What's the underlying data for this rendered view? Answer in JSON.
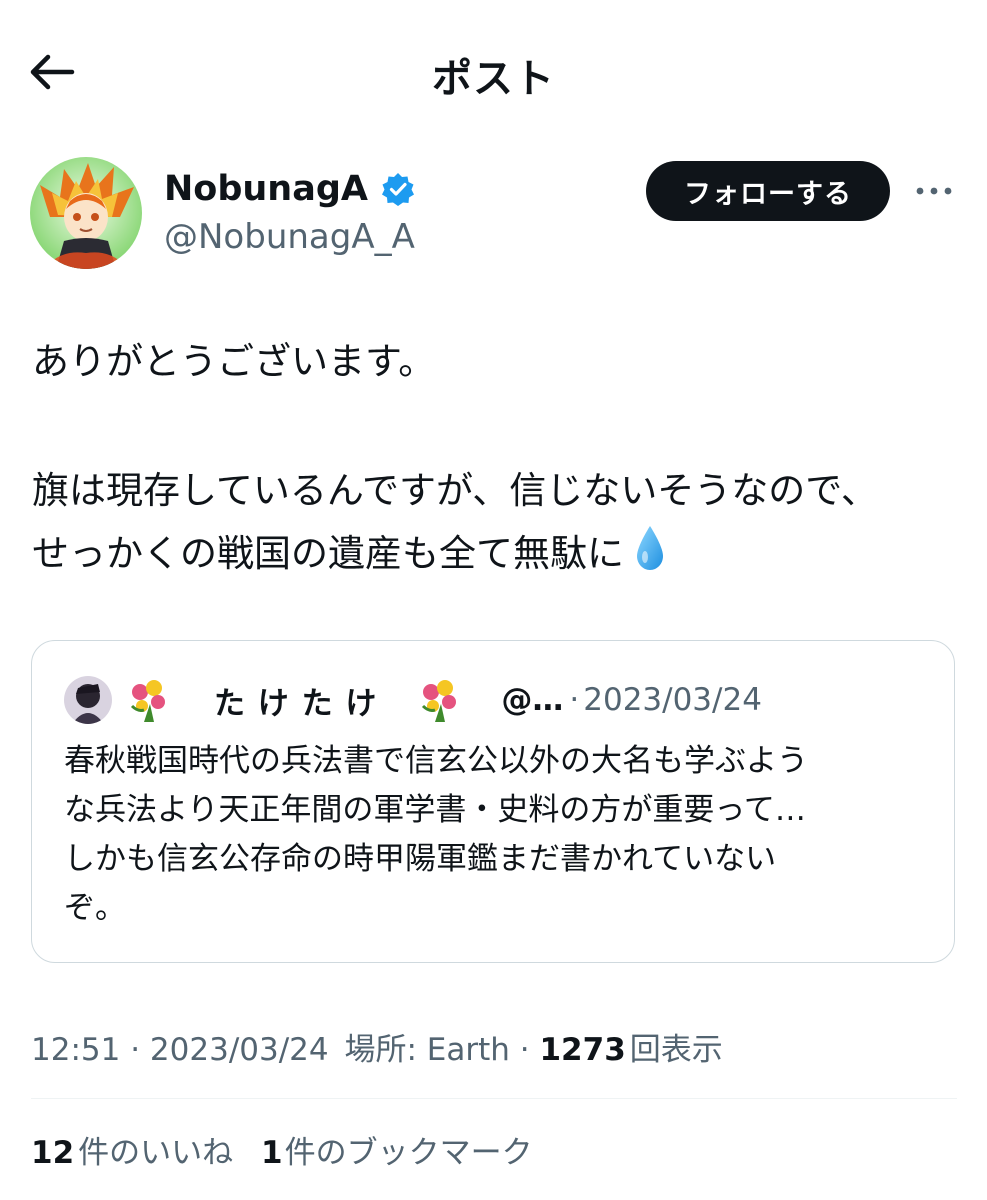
{
  "header": {
    "title": "ポスト",
    "back_icon": "arrow-left-icon"
  },
  "author": {
    "display_name": "NobunagA",
    "handle": "@NobunagA_A",
    "verified": true,
    "verified_color": "#1d9bf0",
    "follow_label": "フォローする",
    "more_icon": "more-horizontal-icon"
  },
  "post": {
    "lines": [
      "ありがとうございます。",
      "旗は現存しているんですが、信じないそうなので、",
      "せっかくの戦国の遺産も全て無駄に"
    ],
    "emoji": "droplet-icon"
  },
  "quote": {
    "name": "た け た け",
    "handle": "@…",
    "separator": "·",
    "date": "2023/03/24",
    "lines": [
      "春秋戦国時代の兵法書で信玄公以外の大名も学ぶよう",
      "な兵法より天正年間の軍学書・史料の方が重要って…",
      "しかも信玄公存命の時甲陽軍鑑まだ書かれていない",
      "ぞ。"
    ]
  },
  "meta": {
    "time": "12:51",
    "separator": "·",
    "date": "2023/03/24",
    "location": "場所: Earth",
    "views_count": "1273",
    "views_label": "回表示"
  },
  "stats": {
    "likes_count": "12",
    "likes_label": "件のいいね",
    "bookmarks_count": "1",
    "bookmarks_label": "件のブックマーク"
  }
}
